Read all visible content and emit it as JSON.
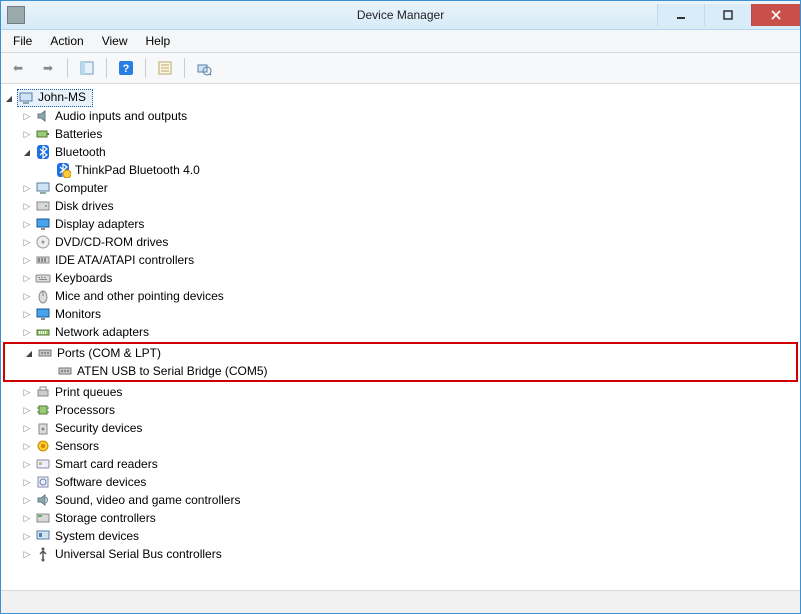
{
  "window": {
    "title": "Device Manager"
  },
  "menu": {
    "file": "File",
    "action": "Action",
    "view": "View",
    "help": "Help"
  },
  "tree": {
    "root": "John-MS",
    "items": [
      {
        "label": "Audio inputs and outputs",
        "expanded": false,
        "icon": "audio"
      },
      {
        "label": "Batteries",
        "expanded": false,
        "icon": "battery"
      },
      {
        "label": "Bluetooth",
        "expanded": true,
        "icon": "bluetooth",
        "children": [
          {
            "label": "ThinkPad Bluetooth 4.0",
            "icon": "bluetooth-dev"
          }
        ]
      },
      {
        "label": "Computer",
        "expanded": false,
        "icon": "computer"
      },
      {
        "label": "Disk drives",
        "expanded": false,
        "icon": "disk"
      },
      {
        "label": "Display adapters",
        "expanded": false,
        "icon": "display"
      },
      {
        "label": "DVD/CD-ROM drives",
        "expanded": false,
        "icon": "cd"
      },
      {
        "label": "IDE ATA/ATAPI controllers",
        "expanded": false,
        "icon": "ide"
      },
      {
        "label": "Keyboards",
        "expanded": false,
        "icon": "keyboard"
      },
      {
        "label": "Mice and other pointing devices",
        "expanded": false,
        "icon": "mouse"
      },
      {
        "label": "Monitors",
        "expanded": false,
        "icon": "monitor"
      },
      {
        "label": "Network adapters",
        "expanded": false,
        "icon": "network"
      },
      {
        "label": "Ports (COM & LPT)",
        "expanded": true,
        "icon": "port",
        "highlight": true,
        "children": [
          {
            "label": "ATEN USB to Serial Bridge (COM5)",
            "icon": "port-dev"
          }
        ]
      },
      {
        "label": "Print queues",
        "expanded": false,
        "icon": "printer"
      },
      {
        "label": "Processors",
        "expanded": false,
        "icon": "cpu"
      },
      {
        "label": "Security devices",
        "expanded": false,
        "icon": "security"
      },
      {
        "label": "Sensors",
        "expanded": false,
        "icon": "sensor"
      },
      {
        "label": "Smart card readers",
        "expanded": false,
        "icon": "smartcard"
      },
      {
        "label": "Software devices",
        "expanded": false,
        "icon": "software"
      },
      {
        "label": "Sound, video and game controllers",
        "expanded": false,
        "icon": "sound"
      },
      {
        "label": "Storage controllers",
        "expanded": false,
        "icon": "storage"
      },
      {
        "label": "System devices",
        "expanded": false,
        "icon": "system"
      },
      {
        "label": "Universal Serial Bus controllers",
        "expanded": false,
        "icon": "usb"
      }
    ]
  }
}
